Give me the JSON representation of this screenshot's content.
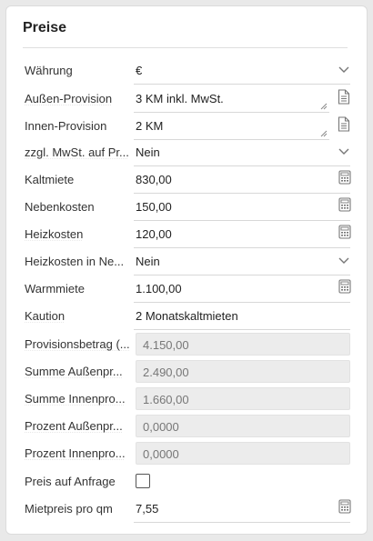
{
  "panel": {
    "title": "Preise"
  },
  "fields": {
    "waehrung": {
      "label": "Währung",
      "value": "€"
    },
    "aussen_provision": {
      "label": "Außen-Provision",
      "value": "3 KM inkl. MwSt."
    },
    "innen_provision": {
      "label": "Innen-Provision",
      "value": "2 KM"
    },
    "zzgl_mwst": {
      "label": "zzgl. MwSt. auf Pr...",
      "value": "Nein"
    },
    "kaltmiete": {
      "label": "Kaltmiete",
      "value": "830,00"
    },
    "nebenkosten": {
      "label": "Nebenkosten",
      "value": "150,00"
    },
    "heizkosten": {
      "label": "Heizkosten",
      "value": "120,00"
    },
    "heizkosten_in_ne": {
      "label": "Heizkosten in Ne...",
      "value": "Nein"
    },
    "warmmiete": {
      "label": "Warmmiete",
      "value": "1.100,00"
    },
    "kaution": {
      "label": "Kaution",
      "value": "2 Monatskaltmieten"
    },
    "provisionsbetrag": {
      "label": "Provisionsbetrag (...",
      "value": "4.150,00"
    },
    "summe_aussen": {
      "label": "Summe Außenpr...",
      "value": "2.490,00"
    },
    "summe_innen": {
      "label": "Summe Innenpro...",
      "value": "1.660,00"
    },
    "prozent_aussen": {
      "label": "Prozent Außenpr...",
      "value": "0,0000"
    },
    "prozent_innen": {
      "label": "Prozent Innenpro...",
      "value": "0,0000"
    },
    "preis_auf_anfrage": {
      "label": "Preis auf Anfrage",
      "checked": false
    },
    "mietpreis_pro_qm": {
      "label": "Mietpreis pro qm",
      "value": "7,55"
    }
  },
  "icons": {
    "dropdown": "chevron-down-icon",
    "calculator": "calculator-icon",
    "document": "document-icon"
  }
}
